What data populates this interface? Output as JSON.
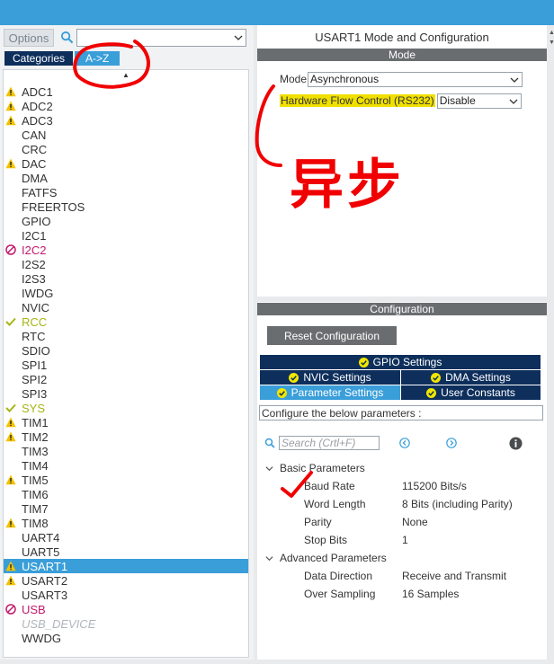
{
  "left": {
    "options_label": "Options",
    "tabs": {
      "categories": "Categories",
      "az": "A->Z"
    },
    "sort_mark": "▲",
    "items": [
      {
        "label": "ADC1",
        "status": "warn"
      },
      {
        "label": "ADC2",
        "status": "warn"
      },
      {
        "label": "ADC3",
        "status": "warn"
      },
      {
        "label": "CAN",
        "status": "none"
      },
      {
        "label": "CRC",
        "status": "none"
      },
      {
        "label": "DAC",
        "status": "warn"
      },
      {
        "label": "DMA",
        "status": "none"
      },
      {
        "label": "FATFS",
        "status": "none"
      },
      {
        "label": "FREERTOS",
        "status": "none"
      },
      {
        "label": "GPIO",
        "status": "none"
      },
      {
        "label": "I2C1",
        "status": "none"
      },
      {
        "label": "I2C2",
        "status": "error"
      },
      {
        "label": "I2S2",
        "status": "none"
      },
      {
        "label": "I2S3",
        "status": "none"
      },
      {
        "label": "IWDG",
        "status": "none"
      },
      {
        "label": "NVIC",
        "status": "none"
      },
      {
        "label": "RCC",
        "status": "ok"
      },
      {
        "label": "RTC",
        "status": "none"
      },
      {
        "label": "SDIO",
        "status": "none"
      },
      {
        "label": "SPI1",
        "status": "none"
      },
      {
        "label": "SPI2",
        "status": "none"
      },
      {
        "label": "SPI3",
        "status": "none"
      },
      {
        "label": "SYS",
        "status": "ok"
      },
      {
        "label": "TIM1",
        "status": "warn"
      },
      {
        "label": "TIM2",
        "status": "warn"
      },
      {
        "label": "TIM3",
        "status": "none"
      },
      {
        "label": "TIM4",
        "status": "none"
      },
      {
        "label": "TIM5",
        "status": "warn"
      },
      {
        "label": "TIM6",
        "status": "none"
      },
      {
        "label": "TIM7",
        "status": "none"
      },
      {
        "label": "TIM8",
        "status": "warn"
      },
      {
        "label": "UART4",
        "status": "none"
      },
      {
        "label": "UART5",
        "status": "none"
      },
      {
        "label": "USART1",
        "status": "warn",
        "selected": true
      },
      {
        "label": "USART2",
        "status": "warn"
      },
      {
        "label": "USART3",
        "status": "none"
      },
      {
        "label": "USB",
        "status": "error"
      },
      {
        "label": "USB_DEVICE",
        "status": "disabled"
      },
      {
        "label": "WWDG",
        "status": "none"
      }
    ]
  },
  "mode_panel": {
    "title": "USART1 Mode and Configuration",
    "section": "Mode",
    "mode_label": "Mode",
    "mode_value": "Asynchronous",
    "flow_label": "Hardware Flow Control (RS232)",
    "flow_value": "Disable"
  },
  "config_panel": {
    "section": "Configuration",
    "reset_label": "Reset Configuration",
    "tabs": {
      "gpio": "GPIO Settings",
      "nvic": "NVIC Settings",
      "dma": "DMA Settings",
      "params": "Parameter Settings",
      "user": "User Constants"
    },
    "instruction": "Configure the below parameters :",
    "search_placeholder": "Search (Crtl+F)",
    "basic_group": "Basic Parameters",
    "advanced_group": "Advanced Parameters",
    "basic": [
      {
        "name": "Baud Rate",
        "value": "115200 Bits/s"
      },
      {
        "name": "Word Length",
        "value": "8 Bits (including Parity)"
      },
      {
        "name": "Parity",
        "value": "None"
      },
      {
        "name": "Stop Bits",
        "value": "1"
      }
    ],
    "advanced": [
      {
        "name": "Data Direction",
        "value": "Receive and Transmit"
      },
      {
        "name": "Over Sampling",
        "value": "16 Samples"
      }
    ]
  },
  "annotation": {
    "text": "异步"
  },
  "colors": {
    "accent": "#3a9ed9",
    "navy": "#0e2f5c",
    "warn": "#f2c300",
    "ok": "#a6b514",
    "error": "#c2196b",
    "annotation": "#f00000",
    "highlight": "#f0e000"
  }
}
